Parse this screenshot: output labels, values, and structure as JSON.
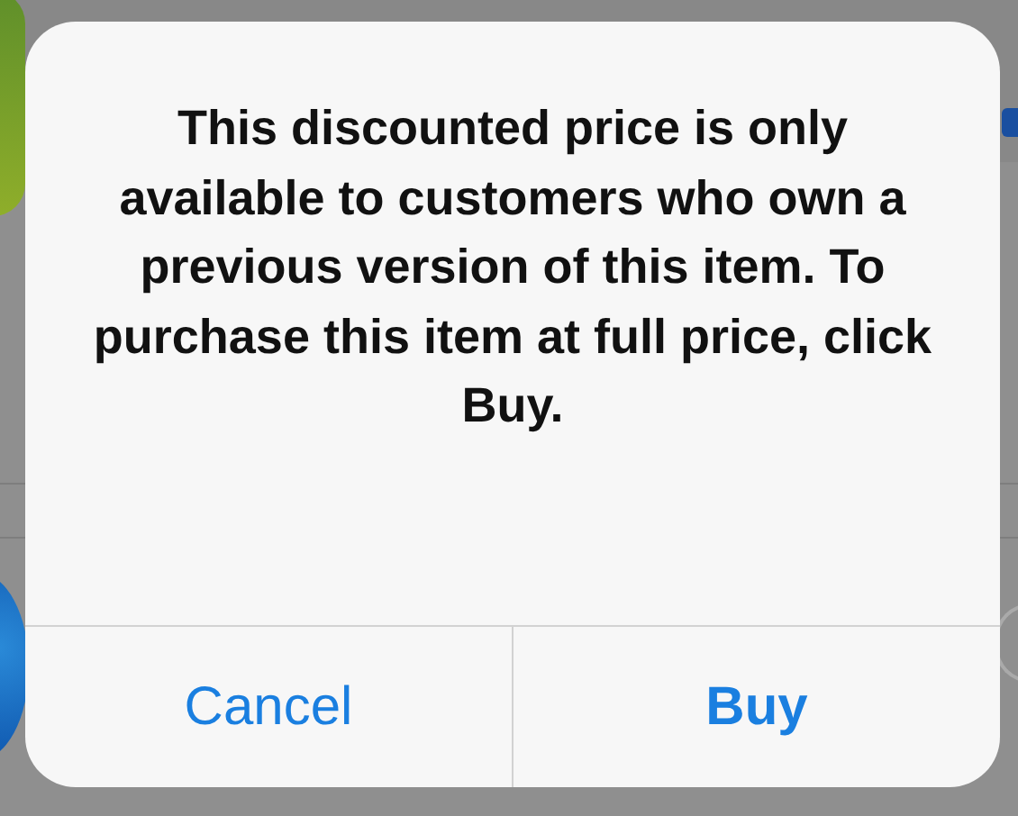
{
  "alert": {
    "message": "This discounted price is only available to customers who own a previous version of this item. To purchase this item at full price, click Buy.",
    "buttons": [
      {
        "label": "Cancel",
        "kind": "cancel"
      },
      {
        "label": "Buy",
        "kind": "default"
      }
    ]
  }
}
